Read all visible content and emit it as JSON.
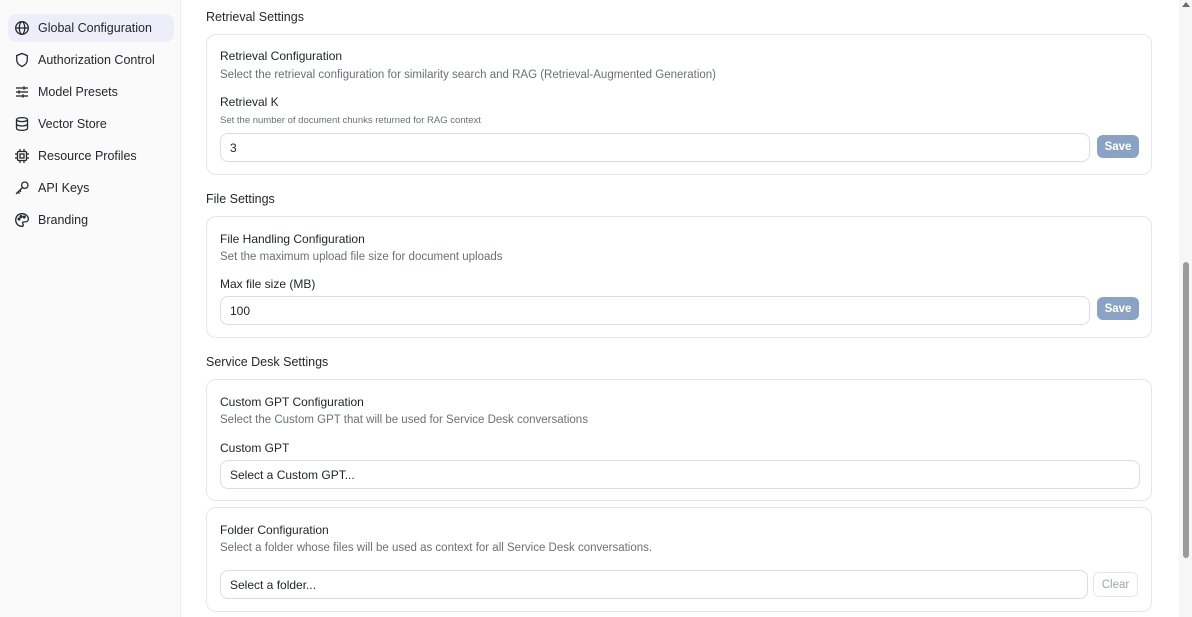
{
  "sidebar": {
    "items": [
      {
        "label": "Global Configuration",
        "icon": "globe-icon",
        "active": true
      },
      {
        "label": "Authorization Control",
        "icon": "shield-icon"
      },
      {
        "label": "Model Presets",
        "icon": "sliders-icon"
      },
      {
        "label": "Vector Store",
        "icon": "database-icon"
      },
      {
        "label": "Resource Profiles",
        "icon": "chip-icon"
      },
      {
        "label": "API Keys",
        "icon": "key-icon"
      },
      {
        "label": "Branding",
        "icon": "palette-icon"
      }
    ]
  },
  "retrieval": {
    "section_title": "Retrieval Settings",
    "card_title": "Retrieval Configuration",
    "card_desc": "Select the retrieval configuration for similarity search and RAG (Retrieval-Augmented Generation)",
    "field_label": "Retrieval K",
    "field_hint": "Set the number of document chunks returned for RAG context",
    "value": "3",
    "save_label": "Save"
  },
  "file": {
    "section_title": "File Settings",
    "card_title": "File Handling Configuration",
    "card_desc": "Set the maximum upload file size for document uploads",
    "field_label": "Max file size (MB)",
    "value": "100",
    "save_label": "Save"
  },
  "service_desk": {
    "section_title": "Service Desk Settings",
    "gpt_card_title": "Custom GPT Configuration",
    "gpt_card_desc": "Select the Custom GPT that will be used for Service Desk conversations",
    "gpt_field_label": "Custom GPT",
    "gpt_placeholder": "Select a Custom GPT...",
    "folder_card_title": "Folder Configuration",
    "folder_card_desc": "Select a folder whose files will be used as context for all Service Desk conversations.",
    "folder_placeholder": "Select a folder...",
    "clear_label": "Clear"
  },
  "colors": {
    "accent_active_bg": "#eeeefa",
    "save_button": "#8aa3c4"
  }
}
